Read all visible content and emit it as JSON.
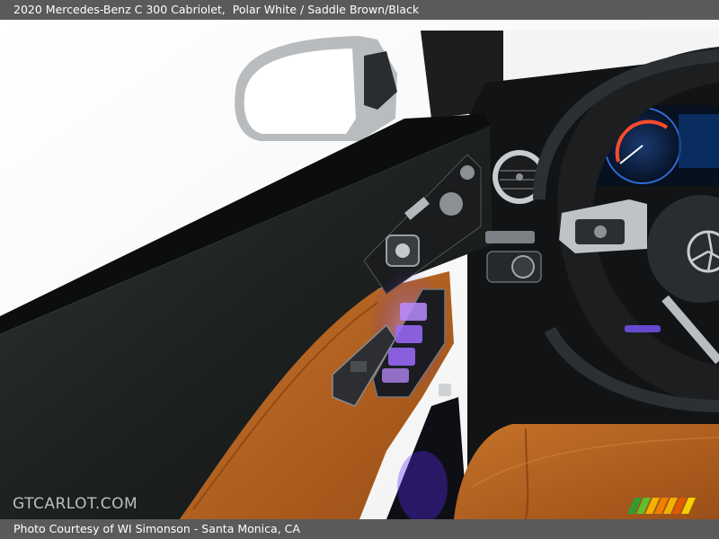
{
  "header": {
    "title": "2020 Mercedes-Benz C 300 Cabriolet,",
    "colors": "Polar White / Saddle Brown/Black"
  },
  "photo": {
    "watermark": "GTCARLOT.COM",
    "logo_icon": "gtcarlot-stripes-logo"
  },
  "footer": {
    "credit": "Photo Courtesy of WI Simonson - Santa Monica, CA"
  },
  "colors": {
    "bar": "#5a5a5a",
    "leather": "#b5621f",
    "door_panel": "#1f2322",
    "ambient": "#8a4dff"
  }
}
